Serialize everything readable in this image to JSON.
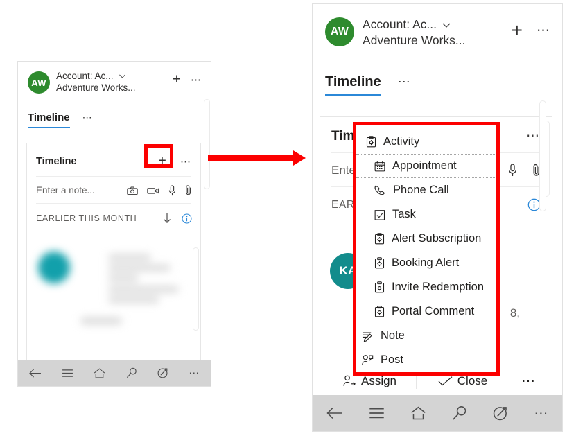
{
  "left_panel": {
    "account": {
      "avatar_initials": "AW",
      "avatar_color": "#2e8b2e",
      "line1": "Account: Ac...",
      "line2": "Adventure Works...",
      "chevron_icon": "chevron-down-icon",
      "add_label": "+",
      "more_label": "⋯"
    },
    "tabs": {
      "active": "Timeline",
      "overflow": "⋯"
    },
    "timeline_card": {
      "title": "Timeline",
      "add_label": "+",
      "more_label": "⋯",
      "note_placeholder": "Enter a note...",
      "note_icons": [
        "camera-icon",
        "video-icon",
        "microphone-icon",
        "attachment-icon"
      ],
      "section_label": "EARLIER THIS MONTH",
      "sort_icon": "arrow-down-icon",
      "info_icon": "info-icon",
      "info_color": "#2b88d8",
      "blurred_avatar_color": "#12a0ab"
    },
    "bottom_nav": [
      {
        "name": "back-icon"
      },
      {
        "name": "menu-icon"
      },
      {
        "name": "home-icon"
      },
      {
        "name": "search-icon"
      },
      {
        "name": "compass-icon"
      },
      {
        "name": "more-icon"
      }
    ]
  },
  "annotation": {
    "highlight_color": "#fc0000",
    "arrow_color": "#fc0000"
  },
  "right_panel": {
    "account": {
      "avatar_initials": "AW",
      "avatar_color": "#2e8b2e",
      "line1": "Account: Ac...",
      "line2": "Adventure Works...",
      "chevron_icon": "chevron-down-icon",
      "add_label": "+",
      "more_label": "⋯"
    },
    "tabs": {
      "active": "Timeline",
      "overflow": "⋯"
    },
    "timeline_card": {
      "title_clipped": "Tim",
      "more_label": "⋯",
      "note_placeholder_clipped": "Ente",
      "note_icons": [
        "microphone-icon",
        "attachment-icon"
      ],
      "section_label_clipped": "EAR",
      "info_icon": "info-icon",
      "info_color": "#2b88d8",
      "record_avatar_initials": "KA",
      "record_avatar_color": "#128c8c",
      "record_text_fragment": "8,"
    },
    "menu": {
      "items": [
        {
          "label": "Activity",
          "icon": "activity-clipboard-icon"
        },
        {
          "label": "Appointment",
          "icon": "calendar-icon",
          "dotted": true
        },
        {
          "label": "Phone Call",
          "icon": "phone-icon"
        },
        {
          "label": "Task",
          "icon": "checkbox-icon"
        },
        {
          "label": "Alert Subscription",
          "icon": "activity-clipboard-icon"
        },
        {
          "label": "Booking Alert",
          "icon": "activity-clipboard-icon"
        },
        {
          "label": "Invite Redemption",
          "icon": "activity-clipboard-icon"
        },
        {
          "label": "Portal Comment",
          "icon": "activity-clipboard-icon"
        },
        {
          "label": "Note",
          "icon": "note-icon"
        },
        {
          "label": "Post",
          "icon": "post-person-icon"
        }
      ]
    },
    "command_bar": {
      "assign_label": "Assign",
      "assign_icon": "assign-person-icon",
      "close_label": "Close",
      "close_icon": "check-icon",
      "more_label": "⋯"
    },
    "bottom_nav": [
      {
        "name": "back-icon"
      },
      {
        "name": "menu-icon"
      },
      {
        "name": "home-icon"
      },
      {
        "name": "search-icon"
      },
      {
        "name": "compass-icon"
      },
      {
        "name": "more-icon"
      }
    ]
  }
}
